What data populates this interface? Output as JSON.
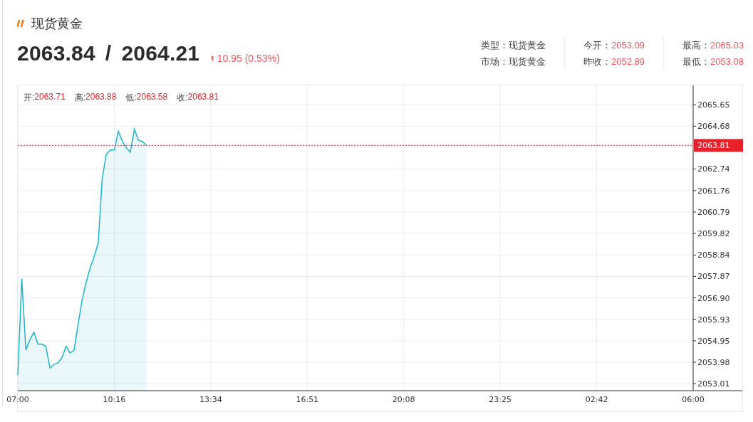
{
  "quote": {
    "name": "现货黄金",
    "bid": "2063.84",
    "separator": "/",
    "ask": "2064.21",
    "change_arrow": "⬆",
    "change": "10.95 (0.53%)"
  },
  "stats": [
    [
      {
        "label": "类型：",
        "value": "现货黄金",
        "kind": "text"
      },
      {
        "label": "市场：",
        "value": "现货黄金",
        "kind": "text"
      }
    ],
    [
      {
        "label": "今开：",
        "value": "2053.09",
        "kind": "price"
      },
      {
        "label": "昨收：",
        "value": "2052.89",
        "kind": "price"
      }
    ],
    [
      {
        "label": "最高：",
        "value": "2065.03",
        "kind": "price"
      },
      {
        "label": "最低：",
        "value": "2053.08",
        "kind": "price"
      }
    ]
  ],
  "chart": {
    "ohlc": [
      {
        "label": "开:",
        "value": "2063.71"
      },
      {
        "label": "高:",
        "value": "2063.88"
      },
      {
        "label": "低:",
        "value": "2063.58"
      },
      {
        "label": "收:",
        "value": "2063.81"
      }
    ],
    "chart_data": {
      "type": "area",
      "grid": true,
      "ylim": [
        2052.69,
        2066.53
      ],
      "ref_lines": [
        {
          "axis": "y",
          "value": 2063.81,
          "label": "2063.81",
          "color": "#e8202a"
        }
      ],
      "categories": [
        "07:00",
        null,
        null,
        null,
        null,
        null,
        null,
        null,
        null,
        null,
        null,
        null,
        null,
        null,
        null,
        null,
        null,
        null,
        null,
        null,
        null,
        null,
        null,
        null,
        "10:16",
        null,
        null,
        null,
        null,
        null,
        null,
        null,
        null,
        null,
        null,
        null,
        null,
        null,
        null,
        null,
        null,
        null,
        null,
        null,
        null,
        null,
        null,
        null,
        "13:34",
        null,
        null,
        null,
        null,
        null,
        null,
        null,
        null,
        null,
        null,
        null,
        null,
        null,
        null,
        null,
        null,
        null,
        null,
        null,
        null,
        null,
        null,
        null,
        "16:51",
        null,
        null,
        null,
        null,
        null,
        null,
        null,
        null,
        null,
        null,
        null,
        null,
        null,
        null,
        null,
        null,
        null,
        null,
        null,
        null,
        null,
        null,
        null,
        "20:08",
        null,
        null,
        null,
        null,
        null,
        null,
        null,
        null,
        null,
        null,
        null,
        null,
        null,
        null,
        null,
        null,
        null,
        null,
        null,
        null,
        null,
        null,
        null,
        "23:25",
        null,
        null,
        null,
        null,
        null,
        null,
        null,
        null,
        null,
        null,
        null,
        null,
        null,
        null,
        null,
        null,
        null,
        null,
        null,
        null,
        null,
        null,
        null,
        "02:42",
        null,
        null,
        null,
        null,
        null,
        null,
        null,
        null,
        null,
        null,
        null,
        null,
        null,
        null,
        null,
        null,
        null,
        null,
        null,
        null,
        null,
        null,
        null,
        "06:00"
      ],
      "series": [
        {
          "color": "#1cb5cf",
          "values": [
            2053.4,
            2057.77,
            2054.53,
            2055.0,
            2055.34,
            2054.8,
            2054.8,
            2054.69,
            2053.72,
            2053.88,
            2053.95,
            2054.2,
            2054.7,
            2054.4,
            2054.53,
            2055.7,
            2056.8,
            2057.6,
            2058.26,
            2058.77,
            2059.4,
            2062.3,
            2063.4,
            2063.6,
            2063.6,
            2064.45,
            2064.0,
            2063.7,
            2063.5,
            2064.55,
            2064.05,
            2063.98,
            2063.81,
            null,
            null,
            null,
            null,
            null,
            null,
            null,
            null,
            null,
            null,
            null,
            null,
            null,
            null,
            null,
            null,
            null,
            null,
            null,
            null,
            null,
            null,
            null,
            null,
            null,
            null,
            null,
            null,
            null,
            null,
            null,
            null,
            null,
            null,
            null,
            null,
            null,
            null,
            null,
            null,
            null,
            null,
            null,
            null,
            null,
            null,
            null,
            null,
            null,
            null,
            null,
            null,
            null,
            null,
            null,
            null,
            null,
            null,
            null,
            null,
            null,
            null,
            null,
            null,
            null,
            null,
            null,
            null,
            null,
            null,
            null,
            null,
            null,
            null,
            null,
            null,
            null,
            null,
            null,
            null,
            null,
            null,
            null,
            null,
            null,
            null,
            null,
            null,
            null,
            null,
            null,
            null,
            null,
            null,
            null,
            null,
            null,
            null,
            null,
            null,
            null,
            null,
            null,
            null,
            null,
            null,
            null,
            null,
            null,
            null,
            null,
            null,
            null,
            null,
            null,
            null,
            null,
            null,
            null,
            null,
            null,
            null,
            null,
            null,
            null,
            null,
            null,
            null,
            null,
            null,
            null,
            null,
            null,
            null,
            null,
            null
          ]
        }
      ],
      "yticks": [
        2065.65,
        2064.68,
        2062.74,
        2061.76,
        2060.79,
        2059.82,
        2058.84,
        2057.87,
        {
          "value": 2056.9,
          "label": "2056.90"
        },
        2055.93,
        2054.95,
        2053.98,
        2053.01
      ]
    }
  }
}
